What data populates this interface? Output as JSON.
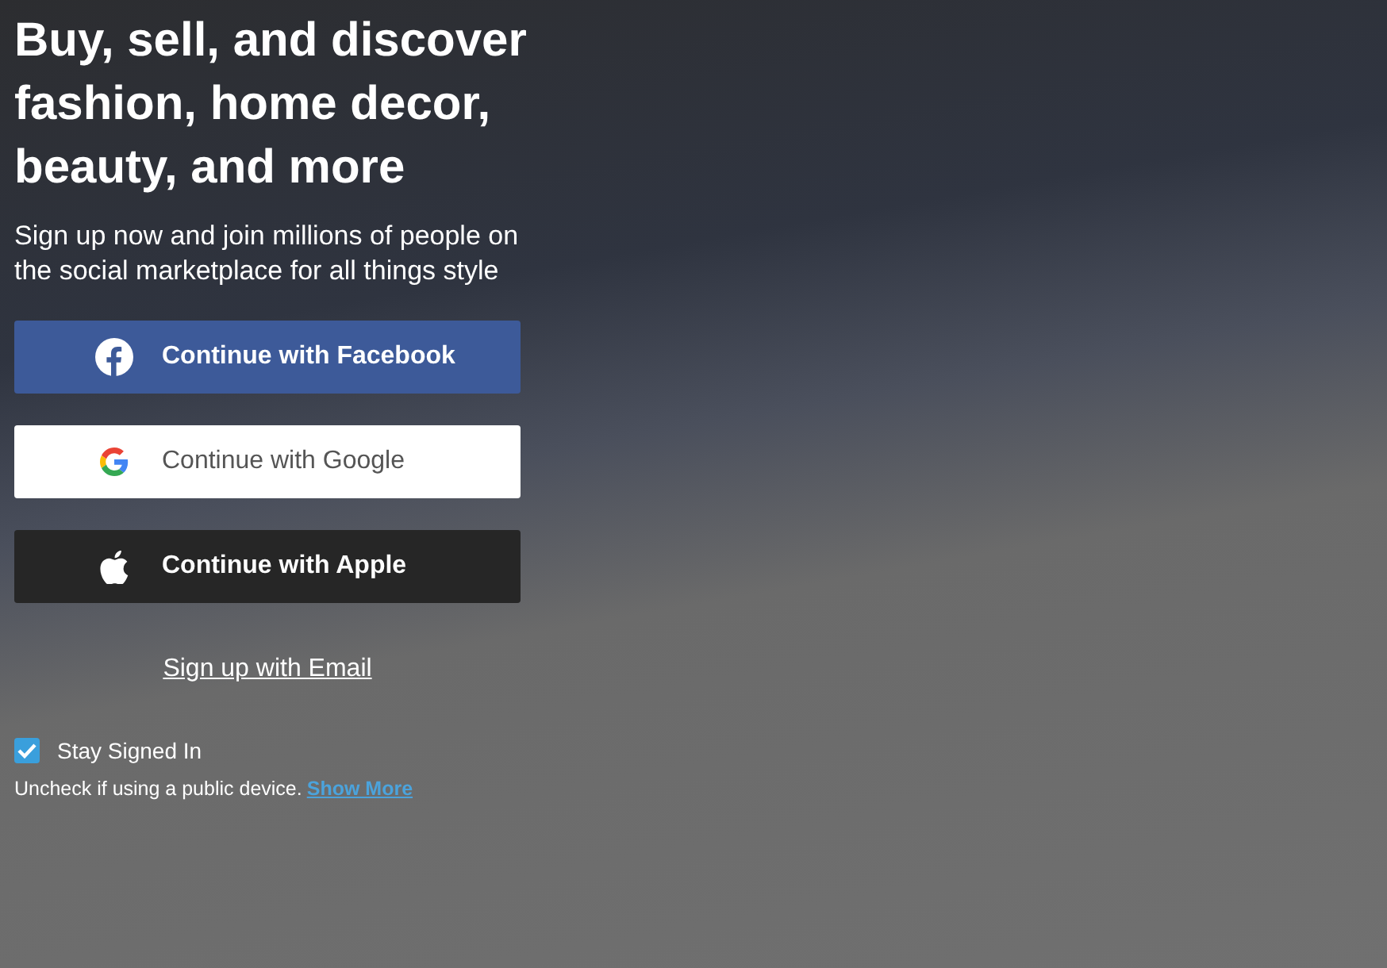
{
  "headline": "Buy, sell, and discover fashion, home decor, beauty, and more",
  "subtitle": "Sign up now and join millions of people on the social marketplace for all things style",
  "buttons": [
    {
      "kind": "facebook",
      "label": "Continue with Facebook"
    },
    {
      "kind": "google",
      "label": "Continue with Google"
    },
    {
      "kind": "apple",
      "label": "Continue with Apple"
    }
  ],
  "email_link": "Sign up with Email",
  "stay_signed_in": {
    "label": "Stay Signed In",
    "checked": true
  },
  "note": {
    "text": "Uncheck if using a public device.",
    "link": "Show More"
  }
}
